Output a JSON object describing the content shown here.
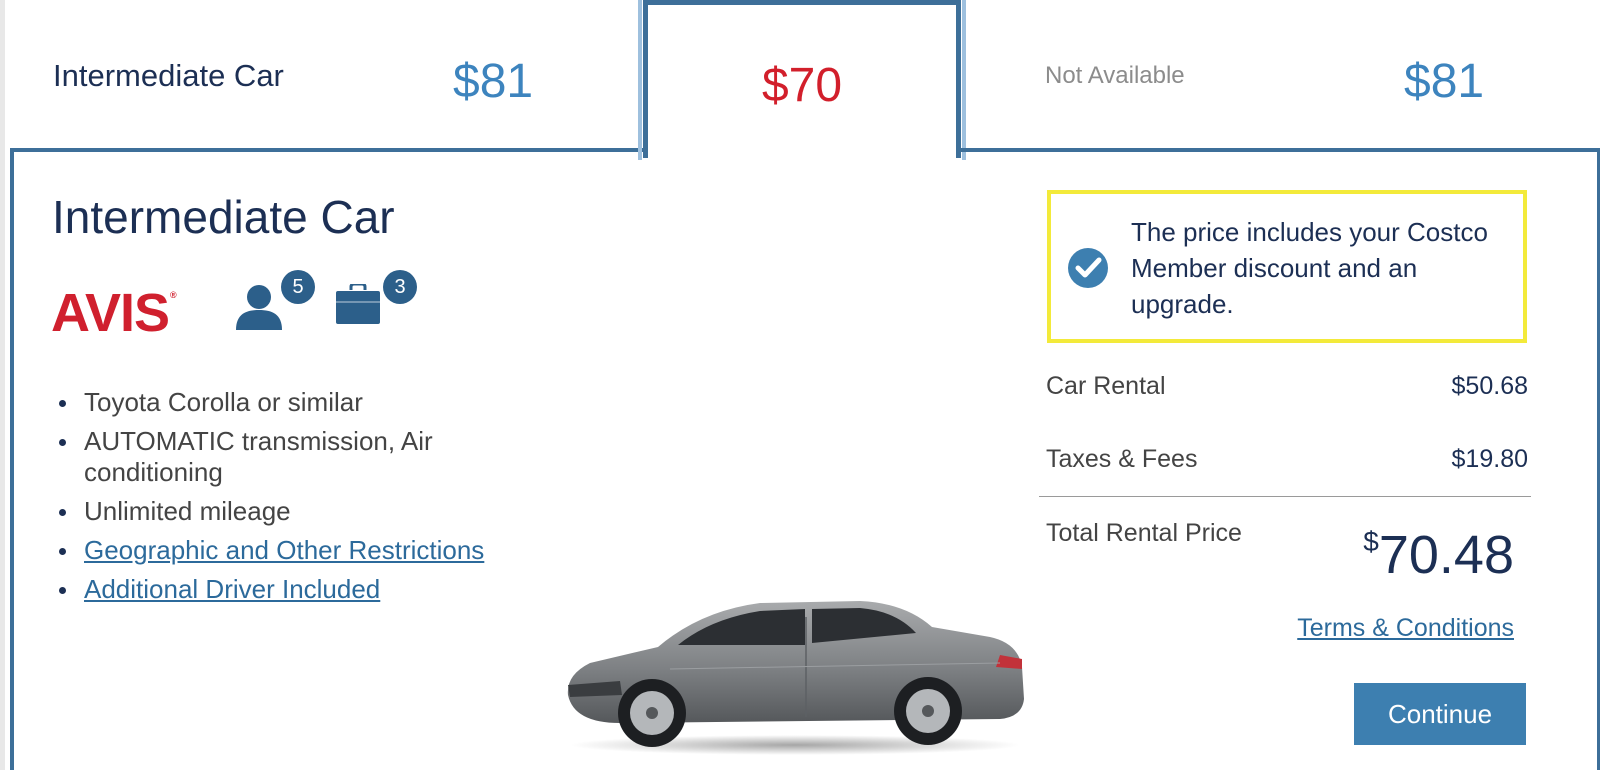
{
  "tabs": [
    {
      "name": "Intermediate Car",
      "price": "$81"
    },
    {
      "name": "",
      "price": "$70"
    },
    {
      "status": "Not Available",
      "price": "$81"
    }
  ],
  "car": {
    "title": "Intermediate Car",
    "brand": "AVIS",
    "brand_mark": "®",
    "passengers": "5",
    "bags": "3",
    "features": [
      "Toyota Corolla or similar",
      "AUTOMATIC transmission, Air conditioning",
      "Unlimited mileage"
    ],
    "links": [
      "Geographic and Other Restrictions",
      "Additional Driver Included"
    ]
  },
  "discount": {
    "text": "The price includes your Costco Member discount and an upgrade."
  },
  "pricing": {
    "car_rental_label": "Car Rental",
    "car_rental_amount": "$50.68",
    "taxes_label": "Taxes & Fees",
    "taxes_amount": "$19.80",
    "total_label": "Total Rental Price",
    "total_currency": "$",
    "total_amount": "70.48",
    "terms_link": "Terms & Conditions",
    "continue_label": "Continue"
  },
  "colors": {
    "brand_red": "#d0202e",
    "tab_border": "#3d6f99",
    "button_blue": "#3d7fb0",
    "price_blue": "#3d84be",
    "selected_red": "#d21f2b",
    "highlight_yellow": "#f3ea3a"
  },
  "icons": [
    "person-icon",
    "briefcase-icon",
    "checkmark-circle-icon"
  ]
}
